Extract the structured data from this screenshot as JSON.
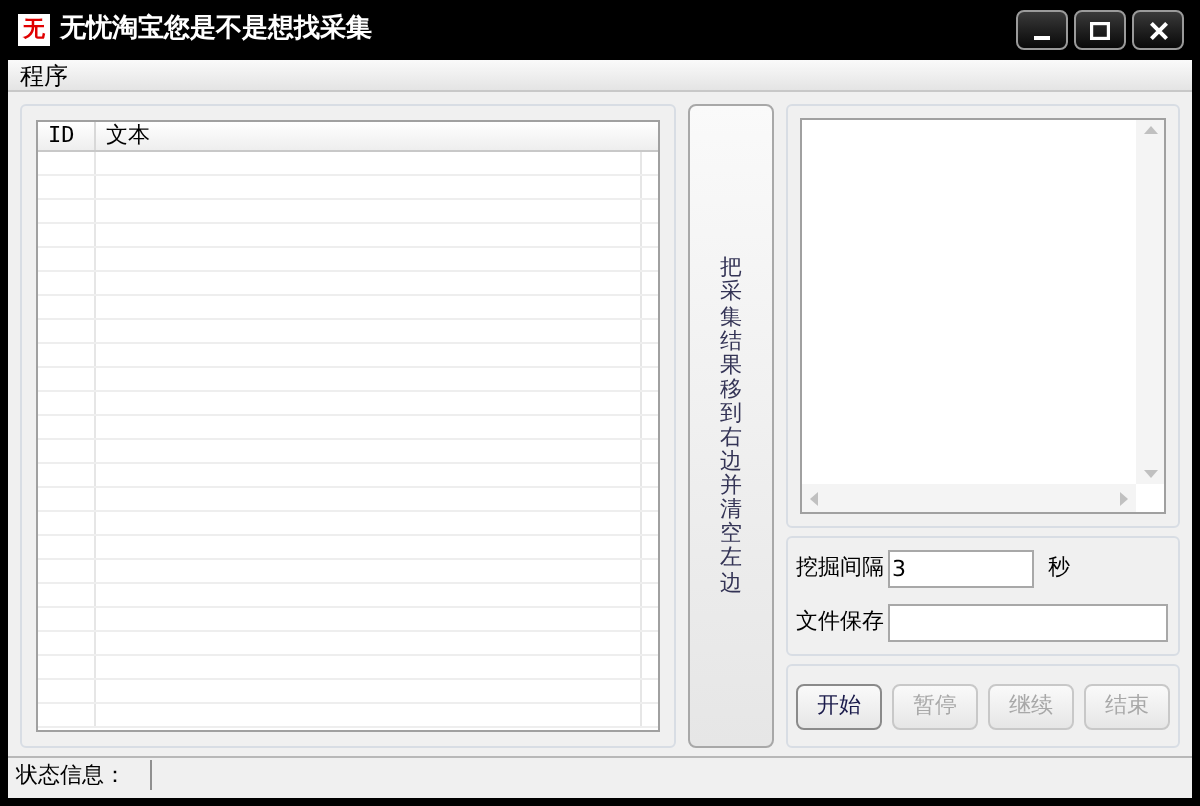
{
  "window": {
    "title": "无忧淘宝您是不是想找采集",
    "controls": [
      {
        "kind": "minimize"
      },
      {
        "kind": "maximize"
      },
      {
        "kind": "close"
      }
    ]
  },
  "app_icon": {
    "text": "无"
  },
  "menu": [
    "程序"
  ],
  "table": {
    "columns": [
      "ID",
      "文本"
    ]
  },
  "move_button": {
    "label": "把采集结果移到右边并清空左边"
  },
  "interval": {
    "label": "挖掘间隔",
    "value": "3",
    "unit": "秒"
  },
  "save": {
    "label": "文件保存"
  },
  "buttons": [
    {
      "label": "开始",
      "disabled": false
    },
    {
      "label": "暂停",
      "disabled": true
    },
    {
      "label": "继续",
      "disabled": true
    },
    {
      "label": "结束",
      "disabled": true
    }
  ],
  "status_bar": {
    "label": "状态信息："
  }
}
